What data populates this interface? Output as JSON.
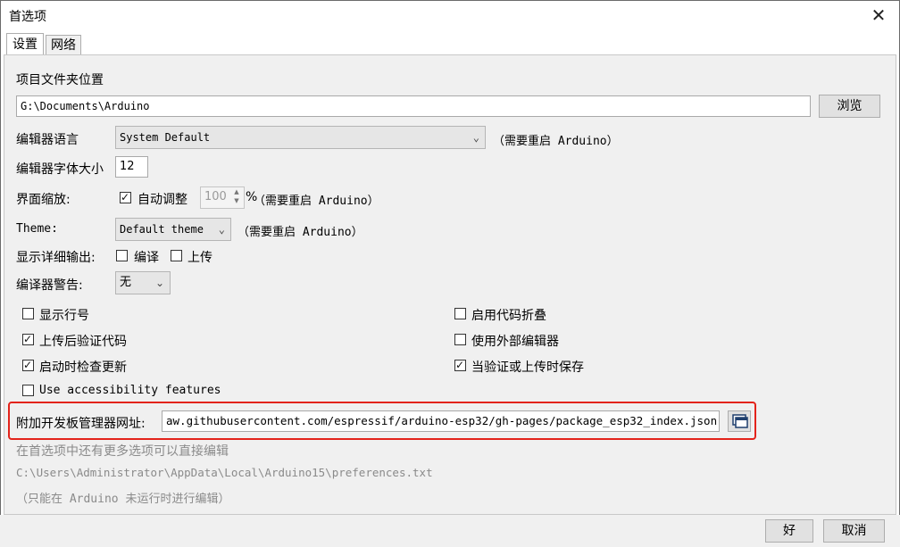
{
  "window": {
    "title": "首选项",
    "close_glyph": "✕"
  },
  "tabs": [
    {
      "label": "设置"
    },
    {
      "label": "网络"
    }
  ],
  "sketchbook": {
    "label": "项目文件夹位置",
    "value": "G:\\Documents\\Arduino",
    "browse_label": "浏览"
  },
  "editor_language": {
    "label": "编辑器语言",
    "value": "System Default",
    "note": "（需要重启 Arduino）"
  },
  "font_size": {
    "label": "编辑器字体大小",
    "value": "12"
  },
  "interface_scale": {
    "label": "界面缩放:",
    "auto_label": "自动调整",
    "auto_checked": true,
    "value": "100",
    "unit": "%",
    "note": "（需要重启 Arduino）"
  },
  "theme": {
    "label": "Theme:",
    "value": "Default theme",
    "note": "（需要重启 Arduino）"
  },
  "verbose_output": {
    "label": "显示详细输出:",
    "compile_label": "编译",
    "upload_label": "上传"
  },
  "compiler_warnings": {
    "label": "编译器警告:",
    "value": "无"
  },
  "options": {
    "line_numbers": "显示行号",
    "verify_after_upload": "上传后验证代码",
    "check_updates": "启动时检查更新",
    "accessibility": "Use accessibility features",
    "code_folding": "启用代码折叠",
    "external_editor": "使用外部编辑器",
    "save_on_verify": "当验证或上传时保存"
  },
  "board_urls": {
    "label": "附加开发板管理器网址:",
    "value": "aw.githubusercontent.com/espressif/arduino-esp32/gh-pages/package_esp32_index.json"
  },
  "info": {
    "more_prefs": "在首选项中还有更多选项可以直接编辑",
    "prefs_path": "C:\\Users\\Administrator\\AppData\\Local\\Arduino15\\preferences.txt",
    "edit_note": "（只能在 Arduino 未运行时进行编辑）"
  },
  "footer": {
    "ok_label": "好",
    "cancel_label": "取消"
  },
  "colors": {
    "highlight": "#e3231b",
    "panel": "#f0f0f0"
  }
}
